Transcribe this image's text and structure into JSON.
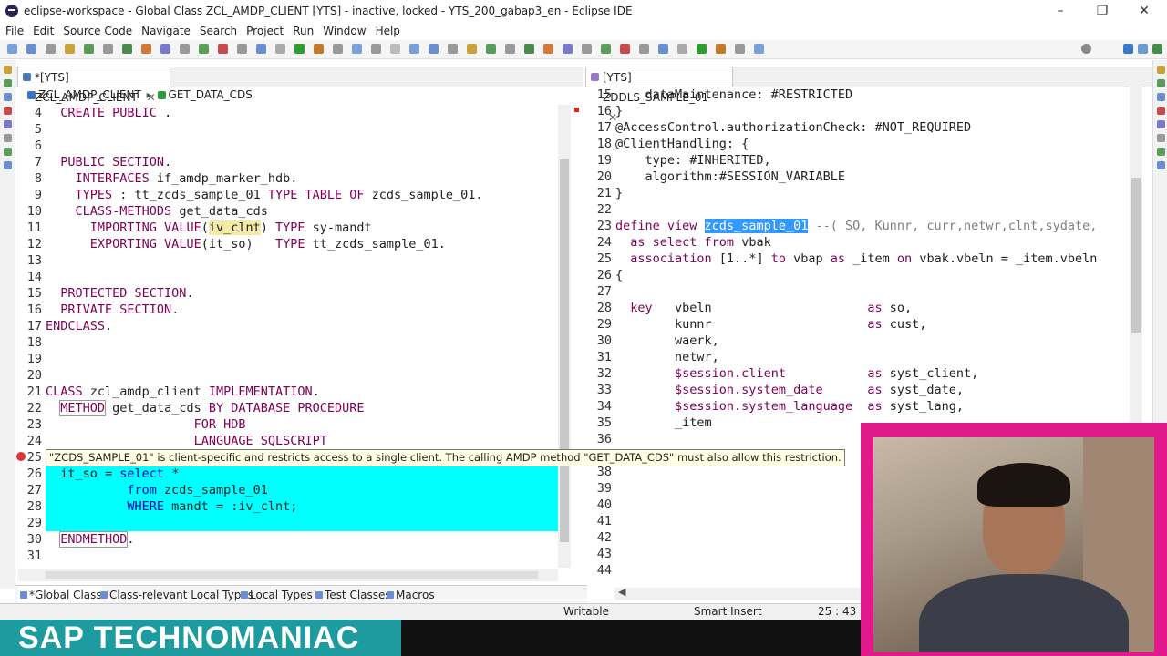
{
  "window": {
    "title": "eclipse-workspace - Global Class ZCL_AMDP_CLIENT [YTS] - inactive, locked - YTS_200_gabap3_en - Eclipse IDE",
    "minimize": "–",
    "maximize": "❐",
    "close": "✕"
  },
  "menu": [
    "File",
    "Edit",
    "Source Code",
    "Navigate",
    "Search",
    "Project",
    "Run",
    "Window",
    "Help"
  ],
  "left_editor": {
    "tab_label": "*[YTS] ZCL_AMDP_CLIENT",
    "breadcrumb": [
      "ZCL_AMDP_CLIENT",
      "GET_DATA_CDS"
    ],
    "lines": [
      {
        "n": "4",
        "segs": [
          {
            "t": "  "
          },
          {
            "t": "CREATE PUBLIC",
            "c": "kw"
          },
          {
            "t": " ."
          }
        ]
      },
      {
        "n": "5",
        "segs": []
      },
      {
        "n": "6",
        "segs": []
      },
      {
        "n": "7",
        "segs": [
          {
            "t": "  "
          },
          {
            "t": "PUBLIC SECTION",
            "c": "kw"
          },
          {
            "t": "."
          }
        ]
      },
      {
        "n": "8",
        "segs": [
          {
            "t": "    "
          },
          {
            "t": "INTERFACES",
            "c": "kw"
          },
          {
            "t": " if_amdp_marker_hdb."
          }
        ]
      },
      {
        "n": "9",
        "segs": [
          {
            "t": "    "
          },
          {
            "t": "TYPES",
            "c": "kw"
          },
          {
            "t": " : tt_zcds_sample_01 "
          },
          {
            "t": "TYPE TABLE OF",
            "c": "kw"
          },
          {
            "t": " zcds_sample_01."
          }
        ]
      },
      {
        "n": "10",
        "segs": [
          {
            "t": "    "
          },
          {
            "t": "CLASS-METHODS",
            "c": "kw"
          },
          {
            "t": " get_data_cds"
          }
        ]
      },
      {
        "n": "11",
        "segs": [
          {
            "t": "      "
          },
          {
            "t": "IMPORTING VALUE",
            "c": "kw"
          },
          {
            "t": "("
          },
          {
            "t": "iv_clnt",
            "c": "hl"
          },
          {
            "t": ") "
          },
          {
            "t": "TYPE",
            "c": "kw"
          },
          {
            "t": " sy-mandt"
          }
        ]
      },
      {
        "n": "12",
        "segs": [
          {
            "t": "      "
          },
          {
            "t": "EXPORTING VALUE",
            "c": "kw"
          },
          {
            "t": "(it_so)   "
          },
          {
            "t": "TYPE",
            "c": "kw"
          },
          {
            "t": " tt_zcds_sample_01."
          }
        ]
      },
      {
        "n": "13",
        "segs": []
      },
      {
        "n": "14",
        "segs": []
      },
      {
        "n": "15",
        "segs": [
          {
            "t": "  "
          },
          {
            "t": "PROTECTED SECTION",
            "c": "kw"
          },
          {
            "t": "."
          }
        ]
      },
      {
        "n": "16",
        "segs": [
          {
            "t": "  "
          },
          {
            "t": "PRIVATE SECTION",
            "c": "kw"
          },
          {
            "t": "."
          }
        ]
      },
      {
        "n": "17",
        "segs": [
          {
            "t": "ENDCLASS",
            "c": "kw"
          },
          {
            "t": "."
          }
        ]
      },
      {
        "n": "18",
        "segs": []
      },
      {
        "n": "19",
        "segs": []
      },
      {
        "n": "20",
        "segs": []
      },
      {
        "n": "21",
        "segs": [
          {
            "t": "CLASS",
            "c": "kw"
          },
          {
            "t": " zcl_amdp_client "
          },
          {
            "t": "IMPLEMENTATION",
            "c": "kw"
          },
          {
            "t": "."
          }
        ]
      },
      {
        "n": "22",
        "segs": [
          {
            "t": "  "
          },
          {
            "t": "METHOD",
            "c": "kwbox"
          },
          {
            "t": " get_data_cds "
          },
          {
            "t": "BY DATABASE PROCEDURE",
            "c": "kw"
          }
        ]
      },
      {
        "n": "23",
        "segs": [
          {
            "t": "                    "
          },
          {
            "t": "FOR HDB",
            "c": "kw"
          }
        ]
      },
      {
        "n": "24",
        "segs": [
          {
            "t": "                    "
          },
          {
            "t": "LANGUAGE SQLSCRIPT",
            "c": "kw"
          }
        ]
      },
      {
        "n": "25",
        "segs": []
      },
      {
        "n": "26",
        "cyan": true,
        "segs": [
          {
            "t": "  it_so = "
          },
          {
            "t": "select",
            "c": "kwb"
          },
          {
            "t": " *"
          }
        ]
      },
      {
        "n": "27",
        "cyan": true,
        "segs": [
          {
            "t": "           "
          },
          {
            "t": "from",
            "c": "kwb"
          },
          {
            "t": " zcds_sample_01"
          }
        ]
      },
      {
        "n": "28",
        "cyan": true,
        "segs": [
          {
            "t": "           "
          },
          {
            "t": "WHERE",
            "c": "kwb"
          },
          {
            "t": " mandt = :iv_clnt;"
          }
        ]
      },
      {
        "n": "29",
        "cyan": true,
        "segs": []
      },
      {
        "n": "30",
        "segs": [
          {
            "t": "  "
          },
          {
            "t": "ENDMETHOD",
            "c": "kwbox"
          },
          {
            "t": "."
          }
        ]
      },
      {
        "n": "31",
        "segs": []
      }
    ]
  },
  "tooltip": "\"ZCDS_SAMPLE_01\" is client-specific and restricts access to a single client. The calling AMDP method \"GET_DATA_CDS\" must also allow this restriction.",
  "right_editor": {
    "tab_label": "[YTS] ZDDLS_SAMPLE_01",
    "lines": [
      {
        "n": "15",
        "segs": [
          {
            "t": "    dataMaintenance: #RESTRICTED"
          }
        ]
      },
      {
        "n": "16",
        "segs": [
          {
            "t": "}"
          }
        ]
      },
      {
        "n": "17",
        "segs": [
          {
            "t": "@AccessControl.authorizationCheck: #NOT_REQUIRED"
          }
        ]
      },
      {
        "n": "18",
        "segs": [
          {
            "t": "@ClientHandling: {"
          }
        ]
      },
      {
        "n": "19",
        "segs": [
          {
            "t": "    type: #INHERITED,"
          }
        ]
      },
      {
        "n": "20",
        "segs": [
          {
            "t": "    algorithm:#SESSION_VARIABLE"
          }
        ]
      },
      {
        "n": "21",
        "segs": [
          {
            "t": "}"
          }
        ]
      },
      {
        "n": "22",
        "segs": []
      },
      {
        "n": "23",
        "segs": [
          {
            "t": "define view",
            "c": "kw"
          },
          {
            "t": " "
          },
          {
            "t": "zcds_sample_01",
            "c": "sel"
          },
          {
            "t": " "
          },
          {
            "t": "--( SO, Kunnr, curr,netwr,clnt,sydate,",
            "c": "cm"
          }
        ]
      },
      {
        "n": "24",
        "segs": [
          {
            "t": "  "
          },
          {
            "t": "as select from",
            "c": "kw"
          },
          {
            "t": " vbak"
          }
        ]
      },
      {
        "n": "25",
        "segs": [
          {
            "t": "  "
          },
          {
            "t": "association",
            "c": "kw"
          },
          {
            "t": " [1..*] "
          },
          {
            "t": "to",
            "c": "kw"
          },
          {
            "t": " vbap "
          },
          {
            "t": "as",
            "c": "kw"
          },
          {
            "t": " _item "
          },
          {
            "t": "on",
            "c": "kw"
          },
          {
            "t": " vbak.vbeln = _item.vbeln"
          }
        ]
      },
      {
        "n": "26",
        "segs": [
          {
            "t": "{"
          }
        ]
      },
      {
        "n": "27",
        "segs": []
      },
      {
        "n": "28",
        "segs": [
          {
            "t": "  "
          },
          {
            "t": "key",
            "c": "kw"
          },
          {
            "t": "   vbeln                     "
          },
          {
            "t": "as",
            "c": "kw"
          },
          {
            "t": " so,"
          }
        ]
      },
      {
        "n": "29",
        "segs": [
          {
            "t": "        kunnr                     "
          },
          {
            "t": "as",
            "c": "kw"
          },
          {
            "t": " cust,"
          }
        ]
      },
      {
        "n": "30",
        "segs": [
          {
            "t": "        waerk,"
          }
        ]
      },
      {
        "n": "31",
        "segs": [
          {
            "t": "        netwr,"
          }
        ]
      },
      {
        "n": "32",
        "segs": [
          {
            "t": "        "
          },
          {
            "t": "$session.client",
            "c": "kw"
          },
          {
            "t": "           "
          },
          {
            "t": "as",
            "c": "kw"
          },
          {
            "t": " syst_client,"
          }
        ]
      },
      {
        "n": "33",
        "segs": [
          {
            "t": "        "
          },
          {
            "t": "$session.system_date",
            "c": "kw"
          },
          {
            "t": "      "
          },
          {
            "t": "as",
            "c": "kw"
          },
          {
            "t": " syst_date,"
          }
        ]
      },
      {
        "n": "34",
        "segs": [
          {
            "t": "        "
          },
          {
            "t": "$session.system_language",
            "c": "kw"
          },
          {
            "t": "  "
          },
          {
            "t": "as",
            "c": "kw"
          },
          {
            "t": " syst_lang,"
          }
        ]
      },
      {
        "n": "35",
        "segs": [
          {
            "t": "        _item"
          }
        ]
      },
      {
        "n": "36",
        "segs": []
      },
      {
        "n": "37",
        "segs": []
      },
      {
        "n": "38",
        "segs": []
      },
      {
        "n": "39",
        "segs": []
      },
      {
        "n": "40",
        "segs": []
      },
      {
        "n": "41",
        "segs": []
      },
      {
        "n": "42",
        "segs": []
      },
      {
        "n": "43",
        "segs": []
      },
      {
        "n": "44",
        "segs": []
      }
    ]
  },
  "bottom_tabs": [
    "*Global Class",
    "Class-relevant Local Types",
    "Local Types",
    "Test Classes",
    "Macros"
  ],
  "status": {
    "mode": "Writable",
    "insert": "Smart Insert",
    "position": "25 : 43 :"
  },
  "brand": "SAP TECHNOMANIAC",
  "colors": {
    "keyword": "#7f0055",
    "selection": "#3399ff",
    "cyan": "#00ffff",
    "brand": "#1d9b9e",
    "webcam_border": "#e01a8a"
  }
}
